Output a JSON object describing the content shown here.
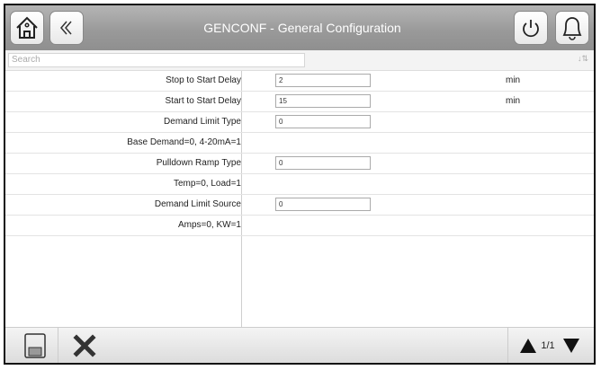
{
  "header": {
    "title": "GENCONF - General Configuration",
    "icons": [
      "home-icon",
      "back-icon",
      "power-icon",
      "alarm-bell-icon"
    ]
  },
  "search": {
    "placeholder": "Search"
  },
  "rows": [
    {
      "label": "Stop to Start Delay",
      "value": "2",
      "unit": "min"
    },
    {
      "label": "Start to Start Delay",
      "value": "15",
      "unit": "min"
    },
    {
      "label": "Demand Limit Type",
      "value": "0",
      "unit": ""
    },
    {
      "label": "Base Demand=0, 4-20mA=1"
    },
    {
      "label": "Pulldown Ramp Type",
      "value": "0",
      "unit": ""
    },
    {
      "label": "Temp=0, Load=1"
    },
    {
      "label": "Demand Limit Source",
      "value": "0",
      "unit": ""
    },
    {
      "label": "Amps=0, KW=1"
    }
  ],
  "footer": {
    "page": "1/1",
    "icons": [
      "save-icon",
      "cancel-icon",
      "page-up-icon",
      "page-down-icon"
    ]
  }
}
